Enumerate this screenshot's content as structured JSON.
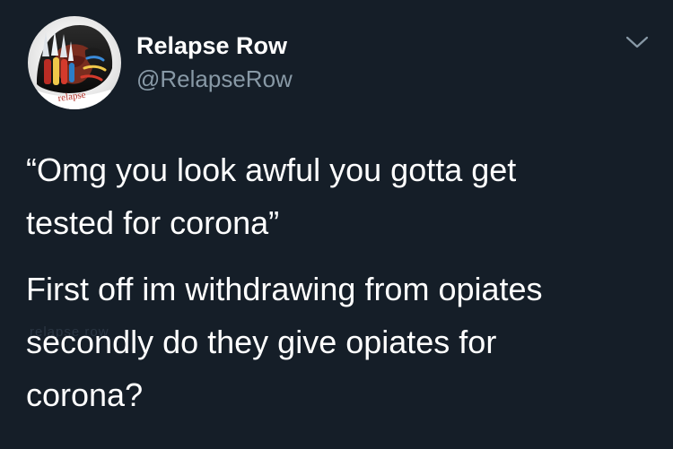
{
  "tweet": {
    "display_name": "Relapse Row",
    "handle": "@RelapseRow",
    "paragraphs": [
      "“Omg you look awful you gotta get\ntested for corona”",
      "First off im withdrawing from opiates\nsecondly do they give opiates for\ncorona?"
    ],
    "avatar": {
      "icon": "hooded-figure-with-claw-glove",
      "logo_text": "relapse"
    },
    "watermark": "relapse row"
  },
  "colors": {
    "background": "#151e28",
    "text": "#ffffff",
    "secondary_text": "#8899a6"
  }
}
